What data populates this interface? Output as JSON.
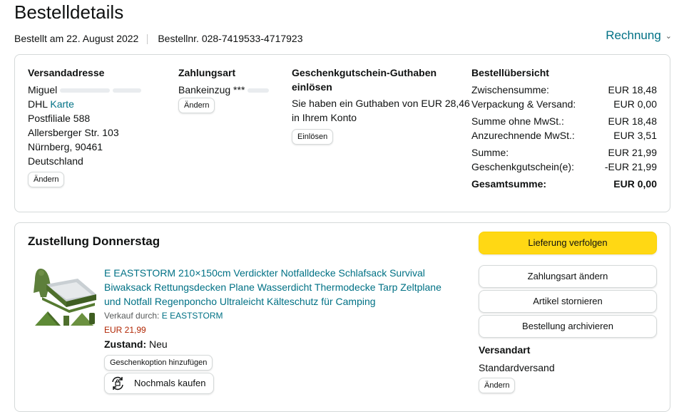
{
  "header": {
    "title": "Bestelldetails",
    "ordered_on": "Bestellt am 22. August 2022",
    "order_number": "Bestellnr. 028-7419533-4717923",
    "invoice_label": "Rechnung",
    "invoice_chevron": "⌄"
  },
  "shipping": {
    "heading": "Versandadresse",
    "name": "Miguel",
    "carrier": "DHL",
    "carrier_link": "Karte",
    "line1": "Postfiliale 588",
    "line2": "Allersberger Str. 103",
    "line3": "Nürnberg, 90461",
    "line4": "Deutschland",
    "change_label": "Ändern"
  },
  "payment": {
    "heading": "Zahlungsart",
    "method": "Bankeinzug ***",
    "change_label": "Ändern"
  },
  "giftcard": {
    "heading": "Geschenkgutschein-Guthaben einlösen",
    "heading_line1": "Geschenkgutschein-Guthaben",
    "heading_line2": "einlösen",
    "text_line1": "Sie haben ein Guthaben von EUR 28,46",
    "text_line2": "in Ihrem Konto",
    "redeem_label": "Einlösen"
  },
  "summary": {
    "heading": "Bestellübersicht",
    "rows": [
      {
        "label": "Zwischensumme:",
        "value": "EUR 18,48"
      },
      {
        "label": "Verpackung & Versand:",
        "value": "EUR 0,00"
      },
      {
        "label": "Summe ohne MwSt.:",
        "value": "EUR 18,48"
      },
      {
        "label": "Anzurechnende MwSt.:",
        "value": "EUR 3,51"
      },
      {
        "label": "Summe:",
        "value": "EUR 21,99"
      },
      {
        "label": "Geschenkgutschein(e):",
        "value": "-EUR 21,99"
      }
    ],
    "total_label": "Gesamtsumme:",
    "total_value": "EUR 0,00"
  },
  "delivery": {
    "heading": "Zustellung Donnerstag",
    "product_title_line1": "E EASTSTORM 210×150cm Verdickter Notfalldecke Schlafsack Survival",
    "product_title_line2": "Biwaksack Rettungsdecken Plane Wasserdicht Thermodecke Tarp Zeltplane",
    "product_title_line3": "und Notfall Regenponcho Ultraleicht Kälteschutz für Camping",
    "seller_prefix": "Verkauf durch:",
    "seller_name": "E EASTSTORM",
    "price": "EUR 21,99",
    "condition_label": "Zustand:",
    "condition_value": "Neu",
    "gift_option_label": "Geschenkoption hinzufügen",
    "buy_again_label": "Nochmals kaufen"
  },
  "actions": {
    "track": "Lieferung verfolgen",
    "change_payment": "Zahlungsart ändern",
    "cancel_items": "Artikel stornieren",
    "archive": "Bestellung archivieren",
    "shipping_type_heading": "Versandart",
    "shipping_type_value": "Standardversand",
    "change_label": "Ändern"
  },
  "colors": {
    "link": "#007185",
    "price": "#b12704",
    "primary_button": "#ffd814",
    "border": "#d5d9d9"
  }
}
